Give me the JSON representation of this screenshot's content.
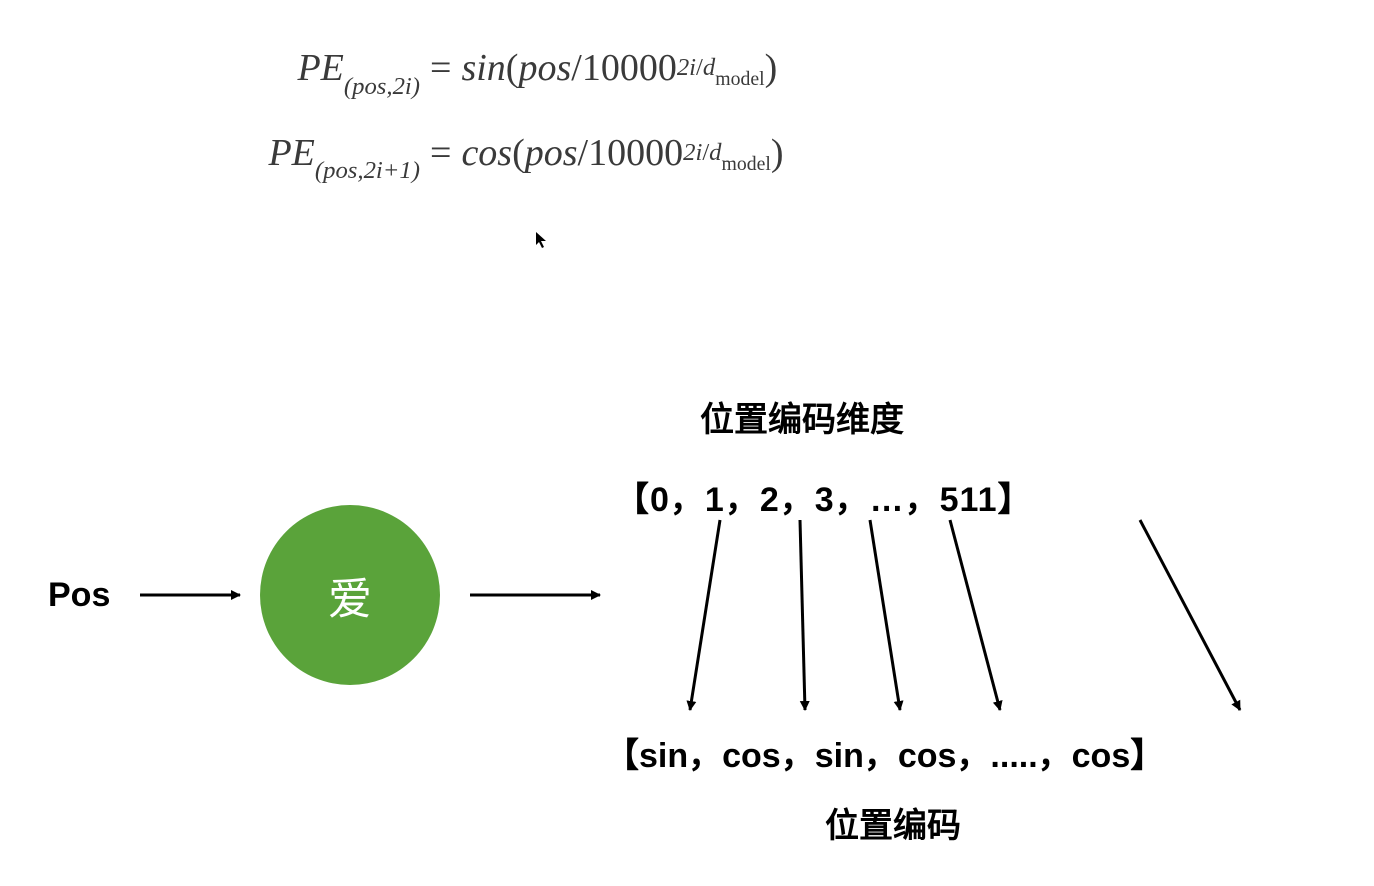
{
  "formulas": {
    "row1": {
      "pe": "PE",
      "sub": "(pos,2i)",
      "eq": "=",
      "fn": "sin",
      "open": "(",
      "arg1": "pos",
      "slash": "/",
      "base": "10000",
      "exp_num": "2i",
      "exp_slash": "/",
      "exp_den1": "d",
      "exp_den2": "model",
      "close": ")"
    },
    "row2": {
      "pe": "PE",
      "sub": "(pos,2i+1)",
      "eq": "=",
      "fn": "cos",
      "open": "(",
      "arg1": "pos",
      "slash": "/",
      "base": "10000",
      "exp_num": "2i",
      "exp_slash": "/",
      "exp_den1": "d",
      "exp_den2": "model",
      "close": ")"
    }
  },
  "diagram": {
    "pos_label": "Pos",
    "token": "爱",
    "dim_title": "位置编码维度",
    "dim_array": "【0，1，2，3，…，511】",
    "enc_array": "【sin，cos，sin，cos，.....，cos】",
    "enc_title": "位置编码"
  },
  "colors": {
    "circle": "#5aa33a",
    "text": "#000000",
    "formula": "#3a3a3a"
  }
}
